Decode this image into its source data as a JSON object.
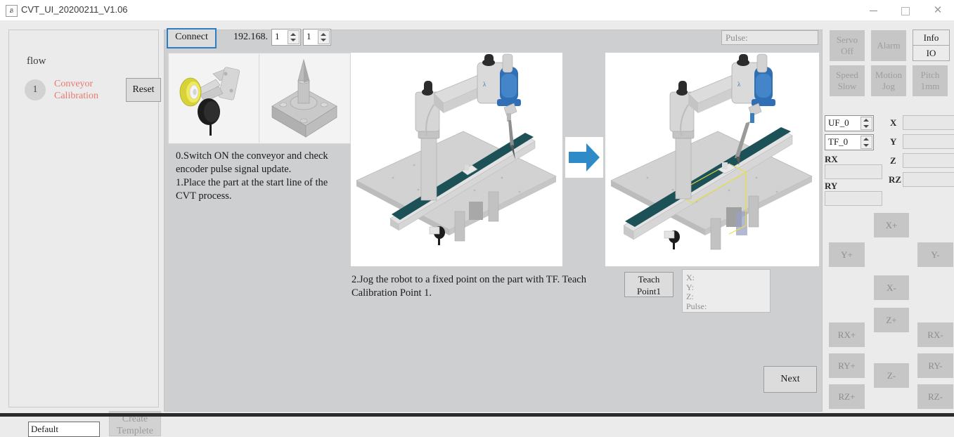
{
  "window": {
    "title": "CVT_UI_20200211_V1.06",
    "icon": "app-icon",
    "minimize": "—",
    "maximize": "☐",
    "close": "✕"
  },
  "flow": {
    "legend": "flow",
    "step_number": "1",
    "step_label": "Conveyor Calibration",
    "reset_label": "Reset",
    "template_value": "Default",
    "create_template_label": "Create Templete"
  },
  "toolbar": {
    "connect_label": "Connect",
    "ip_prefix": "192.168.",
    "ip_octet3": "1",
    "ip_octet4": "1",
    "pulse_placeholder": "Pulse:"
  },
  "instructions": {
    "top": "0.Switch ON the conveyor and check encoder pulse signal update.\n1.Place the part at the start line of the CVT process.",
    "middle": "2.Jog the robot to a fixed point on the part with TF. Teach Calibration Point 1."
  },
  "teach": {
    "button_label": "Teach Point1",
    "readout": "X:\nY:\nZ:\nPulse:"
  },
  "navigation": {
    "next_label": "Next"
  },
  "controls": {
    "servo": "Servo Off",
    "alarm": "Alarm",
    "info": "Info",
    "io": "IO",
    "speed": "Speed Slow",
    "motion": "Motion Jog",
    "pitch": "Pitch 1mm",
    "user_frame": "UF_0",
    "tool_frame": "TF_0"
  },
  "coordinates": {
    "rx_label": "RX",
    "ry_label": "RY",
    "x_label": "X",
    "y_label": "Y",
    "z_label": "Z",
    "rz_label": "RZ",
    "rx_value": "",
    "ry_value": "",
    "x_value": "",
    "y_value": "",
    "z_value": "",
    "rz_value": ""
  },
  "jog": {
    "x_plus": "X+",
    "x_minus": "X-",
    "y_plus": "Y+",
    "y_minus": "Y-",
    "z_plus": "Z+",
    "z_minus": "Z-",
    "rx_plus": "RX+",
    "rx_minus": "RX-",
    "ry_plus": "RY+",
    "ry_minus": "RY-",
    "rz_plus": "RZ+",
    "rz_minus": "RZ-"
  },
  "colors": {
    "accent_blue": "#2d7dc4",
    "step_text": "#e8796f",
    "panel_grey": "#cdcfd0",
    "window_grey": "#ebebeb",
    "conveyor_teal": "#1d5158"
  }
}
